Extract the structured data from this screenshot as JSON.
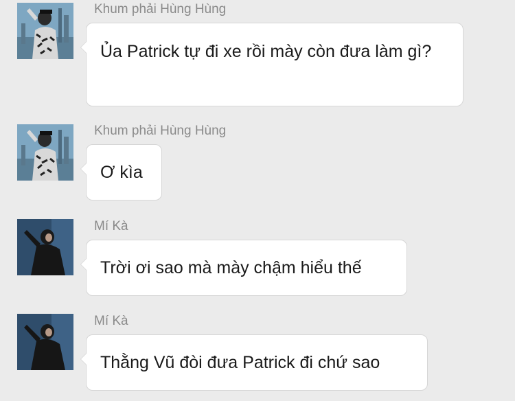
{
  "messages": [
    {
      "sender": "Khum phải Hùng Hùng",
      "text": "Ủa Patrick tự đi xe rồi mày còn đưa làm gì?",
      "avatar": "avatar-city-photo"
    },
    {
      "sender": "Khum phải Hùng Hùng",
      "text": "Ơ kìa",
      "avatar": "avatar-city-photo"
    },
    {
      "sender": "Mí Kà",
      "text": "Trời ơi sao mà mày chậm hiểu thế",
      "avatar": "avatar-dark-photo"
    },
    {
      "sender": "Mí Kà",
      "text": "Thằng Vũ đòi đưa Patrick đi chứ sao",
      "avatar": "avatar-dark-photo"
    }
  ],
  "colors": {
    "background": "#ebebeb",
    "bubble": "#ffffff",
    "bubble_border": "#d6d6d6",
    "sender_text": "#8a8a8a",
    "message_text": "#1a1a1a"
  }
}
